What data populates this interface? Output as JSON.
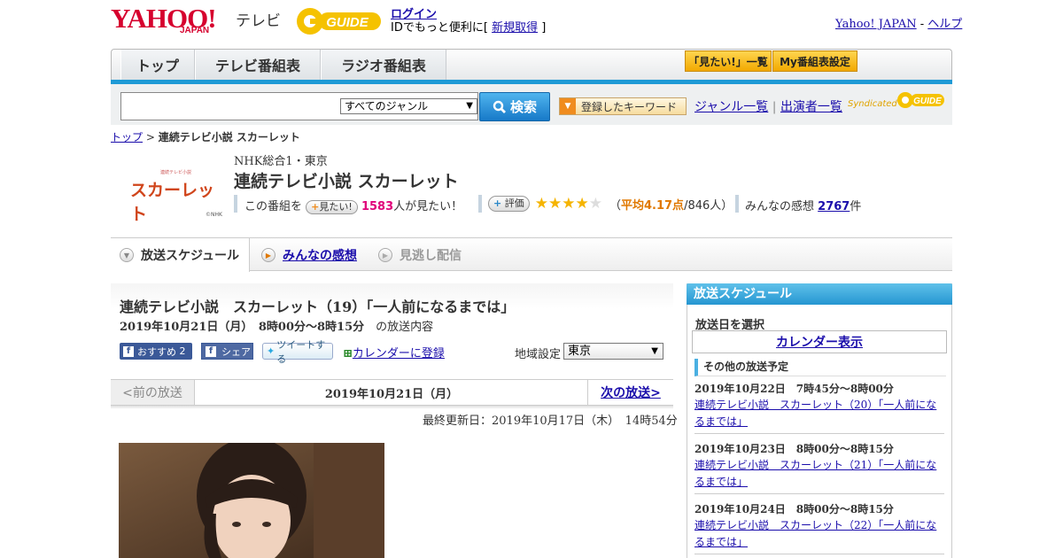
{
  "header": {
    "logo_yahoo": "YAHOO!",
    "logo_japan": "JAPAN",
    "logo_tv": "テレビ",
    "logo_gguide": "GUIDE",
    "login_link": "ログイン",
    "login_sub_pre": "IDでもっと便利に[ ",
    "login_sub_link": "新規取得",
    "login_sub_post": " ]",
    "yahoo_japan_link": "Yahoo! JAPAN",
    "separator": " - ",
    "help_link": "ヘルプ"
  },
  "nav": {
    "tabs": [
      "トップ",
      "テレビ番組表",
      "ラジオ番組表"
    ],
    "want_list_button": "「見たい!」一覧",
    "my_schedule_button": "My番組表設定"
  },
  "search": {
    "placeholder": "",
    "genre_selected": "すべてのジャンル",
    "search_button": "検索",
    "keyword_button": "登録したキーワード",
    "genre_list_link": "ジャンル一覧",
    "divider": "|",
    "performer_list_link": "出演者一覧",
    "syndicated": "Syndicated"
  },
  "breadcrumb": {
    "home": "トップ",
    "sep": " > ",
    "current": "連続テレビ小説 スカーレット"
  },
  "program": {
    "logo_text": "スカーレット",
    "logo_sub": "連続テレビ小説",
    "logo_copyright": "©NHK",
    "channel": "NHK総合1・東京",
    "title": "連続テレビ小説 スカーレット",
    "want_pre": "この番組を",
    "want_button": "見たい!",
    "want_count": "1583",
    "want_post": "人が見たい！",
    "rate_button": "評価",
    "rating": 4.17,
    "rating_pre": "（",
    "rating_avg_label": "平均4.17点",
    "rating_count": "/846人）",
    "impressions_pre": "みんなの感想",
    "impressions_count": "2767",
    "impressions_post": "件"
  },
  "tabs": {
    "schedule": "放送スケジュール",
    "impressions": "みんなの感想",
    "catchup": "見逃し配信"
  },
  "episode": {
    "title": "連続テレビ小説　スカーレット（19）「一人前になるまでは」",
    "date_bold": "2019年10月21日（月）　8時00分～8時15分",
    "date_post": "　の放送内容",
    "fb_recommend": "おすすめ",
    "fb_count": "2",
    "fb_share": "シェア",
    "tweet": "ツイートする",
    "calendar_register": "カレンダーに登録",
    "region_label": "地域設定",
    "region_selected": "東京"
  },
  "pager": {
    "prev": "<前の放送",
    "current": "2019年10月21日（月）",
    "next": "次の放送>"
  },
  "updated": "最終更新日：2019年10月17日（木）　14時54分",
  "sidebar": {
    "title": "放送スケジュール",
    "date_select_label": "放送日を選択",
    "calendar_button": "カレンダー表示",
    "other_heading": "その他の放送予定",
    "items": [
      {
        "datetime": "2019年10月22日　7時45分～8時00分",
        "title": "連続テレビ小説　スカーレット（20）「一人前になるまでは」"
      },
      {
        "datetime": "2019年10月23日　8時00分～8時15分",
        "title": "連続テレビ小説　スカーレット（21）「一人前になるまでは」"
      },
      {
        "datetime": "2019年10月24日　8時00分～8時15分",
        "title": "連続テレビ小説　スカーレット（22）「一人前になるまでは」"
      }
    ]
  },
  "colors": {
    "accent_blue": "#1e9ad6",
    "yahoo_red": "#d6002e",
    "want_pink": "#e0007a",
    "rating_orange": "#e07800",
    "star_gold": "#f5b400"
  }
}
